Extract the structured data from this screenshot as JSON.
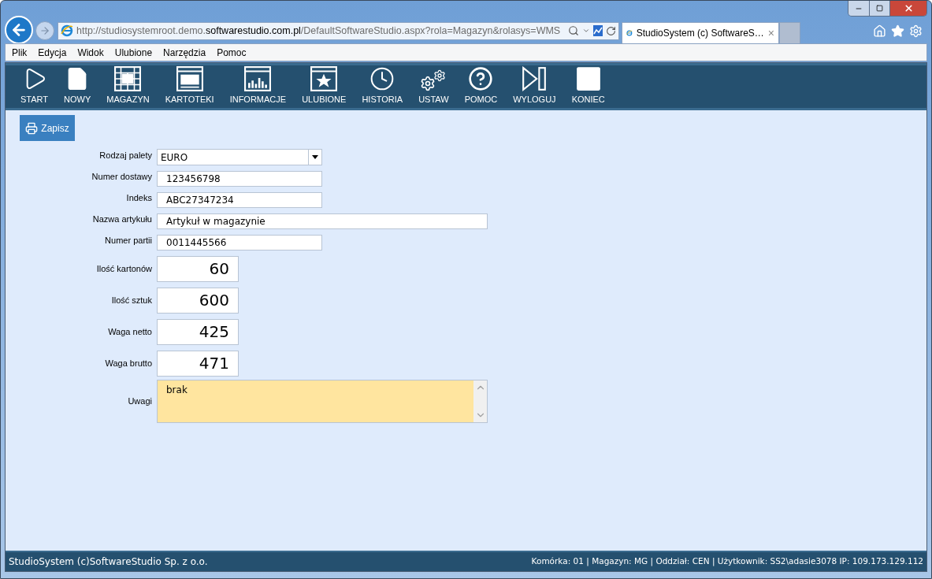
{
  "browser": {
    "address": [
      {
        "text": "http://studiosystemroot.demo.",
        "emphasis": false
      },
      {
        "text": "softwarestudio.com.pl",
        "emphasis": true
      },
      {
        "text": "/DefaultSoftwareStudio.aspx?rola=Magazyn&rolasys=WMS",
        "emphasis": false
      }
    ],
    "tab": {
      "title": "StudioSystem (c) SoftwareS…",
      "close": "×"
    },
    "menu": [
      "Plik",
      "Edycja",
      "Widok",
      "Ulubione",
      "Narzędzia",
      "Pomoc"
    ]
  },
  "toolbar": [
    {
      "label": "START",
      "kind": "play"
    },
    {
      "label": "NOWY",
      "kind": "page"
    },
    {
      "label": "MAGAZYN",
      "kind": "grid"
    },
    {
      "label": "KARTOTEKI",
      "kind": "window"
    },
    {
      "label": "INFORMACJE",
      "kind": "chart"
    },
    {
      "label": "ULUBIONE",
      "kind": "star"
    },
    {
      "label": "HISTORIA",
      "kind": "clock"
    },
    {
      "label": "USTAW",
      "kind": "gears"
    },
    {
      "label": "POMOC",
      "kind": "help"
    },
    {
      "label": "WYLOGUJ",
      "kind": "logout"
    },
    {
      "label": "KONIEC",
      "kind": "square"
    }
  ],
  "save_button": "Zapisz",
  "form": [
    {
      "label": "Rodzaj palety",
      "kind": "select",
      "value": "EURO"
    },
    {
      "label": "Numer dostawy",
      "kind": "text",
      "value": "123456798",
      "wide": false
    },
    {
      "label": "Indeks",
      "kind": "text",
      "value": "ABC27347234",
      "wide": false
    },
    {
      "label": "Nazwa artykułu",
      "kind": "text",
      "value": "Artykuł w magazynie",
      "wide": true
    },
    {
      "label": "Numer partii",
      "kind": "text",
      "value": "0011445566",
      "wide": false
    },
    {
      "label": "Ilość kartonów",
      "kind": "number",
      "value": "60"
    },
    {
      "label": "Ilość sztuk",
      "kind": "number",
      "value": "600"
    },
    {
      "label": "Waga netto",
      "kind": "number",
      "value": "425"
    },
    {
      "label": "Waga brutto",
      "kind": "number",
      "value": "471"
    },
    {
      "label": "Uwagi",
      "kind": "textarea",
      "value": "brak"
    }
  ],
  "status_bar": {
    "left": "StudioSystem (c)SoftwareStudio Sp. z o.o.",
    "right": "Komórka: 01 | Magazyn: MG | Oddział: CEN | Użytkownik: SS2\\adasie3078 IP: 109.173.129.112"
  }
}
